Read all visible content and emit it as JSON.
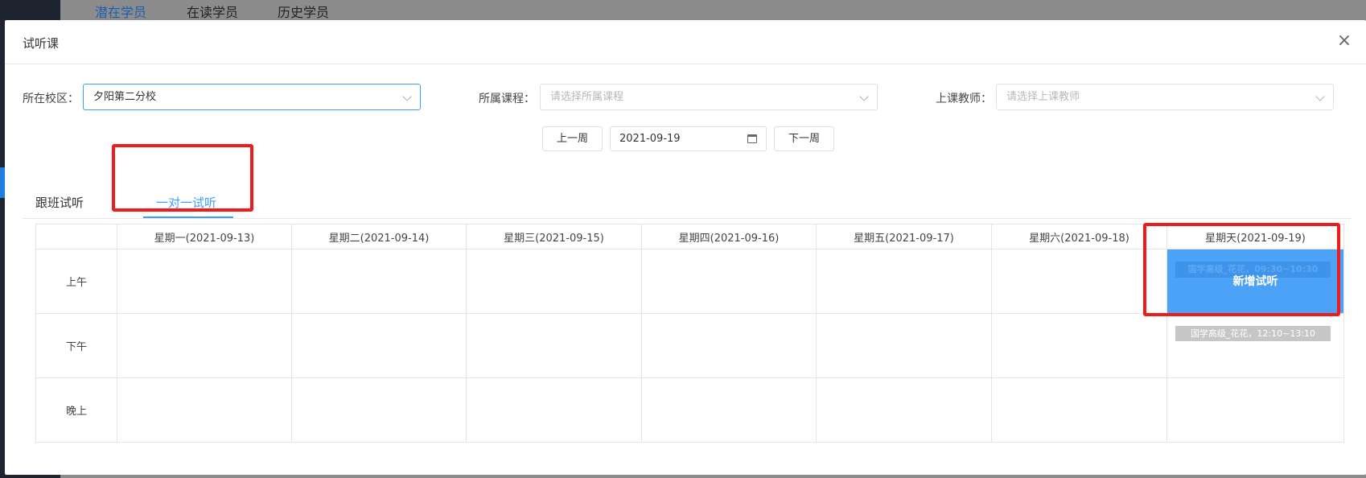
{
  "background": {
    "tabs": [
      "潜在学员",
      "在读学员",
      "历史学员"
    ]
  },
  "modal": {
    "title": "试听课",
    "close": "×"
  },
  "filters": {
    "campus_label": "所在校区：",
    "campus_value": "夕阳第二分校",
    "course_label": "所属课程：",
    "course_placeholder": "请选择所属课程",
    "teacher_label": "上课教师：",
    "teacher_placeholder": "请选择上课教师"
  },
  "week_nav": {
    "prev": "上一周",
    "date": "2021-09-19",
    "next": "下一周"
  },
  "tabs": [
    "跟班试听",
    "一对一试听"
  ],
  "calendar": {
    "days": [
      "星期一(2021-09-13)",
      "星期二(2021-09-14)",
      "星期三(2021-09-15)",
      "星期四(2021-09-16)",
      "星期五(2021-09-17)",
      "星期六(2021-09-18)",
      "星期天(2021-09-19)"
    ],
    "periods": [
      "上午",
      "下午",
      "晚上"
    ],
    "morning_sun_chip": "国学高级_花花，09:30~10:30",
    "new_trial": "新增试听",
    "afternoon_sun_chip": "国学高级_花花，12:10~13:10"
  },
  "colors": {
    "accent": "#409eff",
    "highlight": "#f01c1c",
    "new_trial_bg": "#4ba2f7"
  }
}
